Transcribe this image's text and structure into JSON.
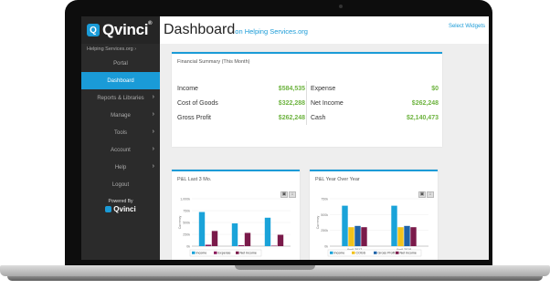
{
  "app": {
    "logo": "Qvinci",
    "org": "Helping Services.org",
    "title": "Dashboard",
    "subtitle": "on Helping Services.org",
    "select_widgets": "Select Widgets"
  },
  "nav": [
    {
      "label": "Portal",
      "chevron": false,
      "active": false
    },
    {
      "label": "Dashboard",
      "chevron": false,
      "active": true
    },
    {
      "label": "Reports & Libraries",
      "chevron": true,
      "active": false
    },
    {
      "label": "Manage",
      "chevron": true,
      "active": false
    },
    {
      "label": "Tools",
      "chevron": true,
      "active": false
    },
    {
      "label": "Account",
      "chevron": true,
      "active": false
    },
    {
      "label": "Help",
      "chevron": true,
      "active": false
    },
    {
      "label": "Logout",
      "chevron": false,
      "active": false
    }
  ],
  "powered_by": "Powered By",
  "financial": {
    "title": "Financial Summary (This Month)",
    "left": [
      {
        "label": "Income",
        "value": "$584,535"
      },
      {
        "label": "Cost of Goods",
        "value": "$322,288"
      },
      {
        "label": "Gross Profit",
        "value": "$262,248"
      }
    ],
    "right": [
      {
        "label": "Expense",
        "value": "$0"
      },
      {
        "label": "Net Income",
        "value": "$262,248"
      },
      {
        "label": "Cash",
        "value": "$2,140,473"
      }
    ]
  },
  "colors": {
    "income": "#1aa3d9",
    "expense": "#8b1a5c",
    "net_income": "#7a1a4a",
    "cogs": "#f2c21b",
    "gross_profit": "#1f63a8"
  },
  "chart_data": [
    {
      "type": "bar",
      "title": "P&L Last 3 Mo.",
      "ylabel": "Currency",
      "ylim": [
        0,
        1000000
      ],
      "yticks": [
        "1,000k",
        "750k",
        "500k",
        "250k",
        "0k"
      ],
      "categories": [
        "",
        "",
        ""
      ],
      "series": [
        {
          "name": "Income",
          "values": [
            720000,
            480000,
            600000
          ]
        },
        {
          "name": "Expense",
          "values": [
            30000,
            20000,
            10000
          ]
        },
        {
          "name": "Net Income",
          "values": [
            320000,
            280000,
            240000
          ]
        }
      ]
    },
    {
      "type": "bar",
      "title": "P&L Year Over Year",
      "ylabel": "Currency",
      "ylim": [
        0,
        750000
      ],
      "yticks": [
        "750k",
        "500k",
        "250k",
        "0k"
      ],
      "categories": [
        "April 2017",
        "April 2018"
      ],
      "series": [
        {
          "name": "Income",
          "values": [
            640000,
            640000
          ]
        },
        {
          "name": "COGS",
          "values": [
            300000,
            300000
          ]
        },
        {
          "name": "Gross Profit",
          "values": [
            320000,
            320000
          ]
        },
        {
          "name": "Net Income",
          "values": [
            300000,
            300000
          ]
        }
      ]
    }
  ]
}
